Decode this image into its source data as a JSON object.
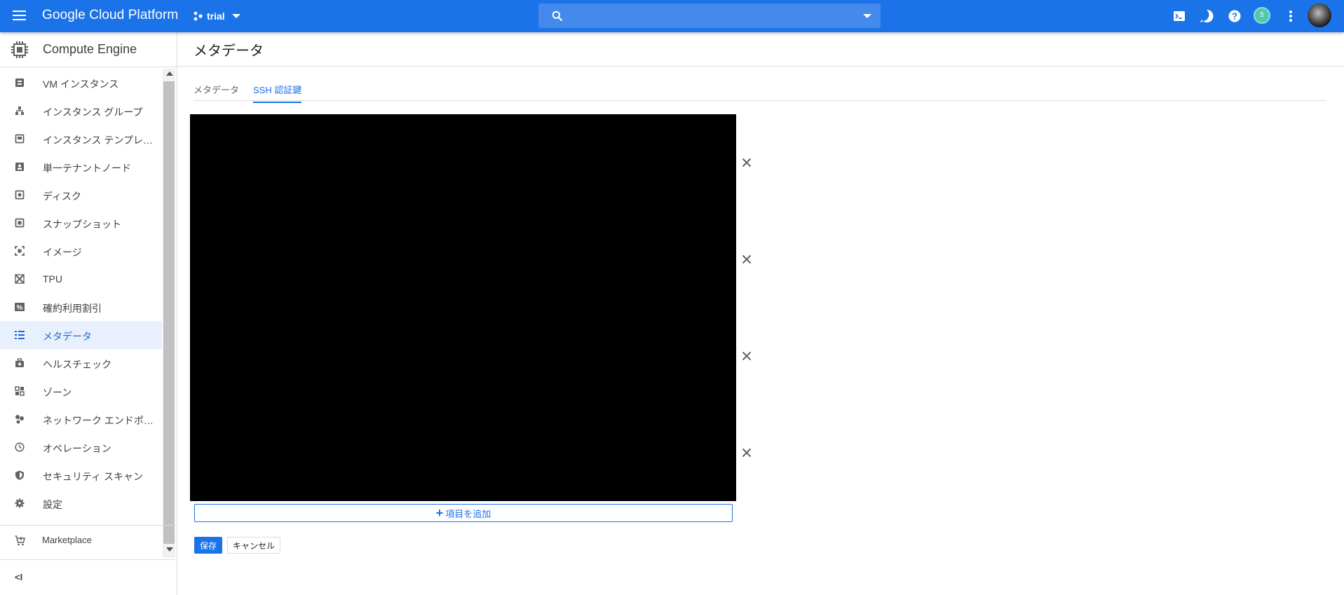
{
  "header": {
    "brand": "Google Cloud Platform",
    "project": "trial",
    "search_placeholder": "",
    "notification_count": "5",
    "icons": [
      "menu-icon",
      "project-icon",
      "search-icon",
      "cloud-shell-icon",
      "notifications-icon",
      "help-icon",
      "more-vert-icon",
      "avatar"
    ]
  },
  "sidebar": {
    "product": "Compute Engine",
    "items": [
      {
        "label": "VM インスタンス",
        "icon": "vm-instances-icon"
      },
      {
        "label": "インスタンス グループ",
        "icon": "instance-groups-icon"
      },
      {
        "label": "インスタンス テンプレ…",
        "icon": "instance-templates-icon"
      },
      {
        "label": "単一テナントノード",
        "icon": "sole-tenant-icon"
      },
      {
        "label": "ディスク",
        "icon": "disk-icon"
      },
      {
        "label": "スナップショット",
        "icon": "snapshot-icon"
      },
      {
        "label": "イメージ",
        "icon": "image-icon"
      },
      {
        "label": "TPU",
        "icon": "tpu-icon"
      },
      {
        "label": "確約利用割引",
        "icon": "percent-icon"
      },
      {
        "label": "メタデータ",
        "icon": "metadata-icon",
        "active": true
      },
      {
        "label": "ヘルスチェック",
        "icon": "health-check-icon"
      },
      {
        "label": "ゾーン",
        "icon": "zones-icon"
      },
      {
        "label": "ネットワーク エンドポ…",
        "icon": "network-endpoint-icon"
      },
      {
        "label": "オペレーション",
        "icon": "clock-icon"
      },
      {
        "label": "セキュリティ スキャン",
        "icon": "shield-icon"
      },
      {
        "label": "設定",
        "icon": "gear-icon"
      }
    ],
    "marketplace": "Marketplace",
    "collapse": "<I"
  },
  "main": {
    "title": "メタデータ",
    "tabs": [
      {
        "label": "メタデータ",
        "active": false
      },
      {
        "label": "SSH 認証鍵",
        "active": true
      }
    ],
    "add_item": "項目を追加",
    "save": "保存",
    "cancel": "キャンセル"
  },
  "colors": {
    "brand_blue": "#1a73e8",
    "active_bg": "#e8f0fe",
    "badge": "#4ec9b0"
  }
}
